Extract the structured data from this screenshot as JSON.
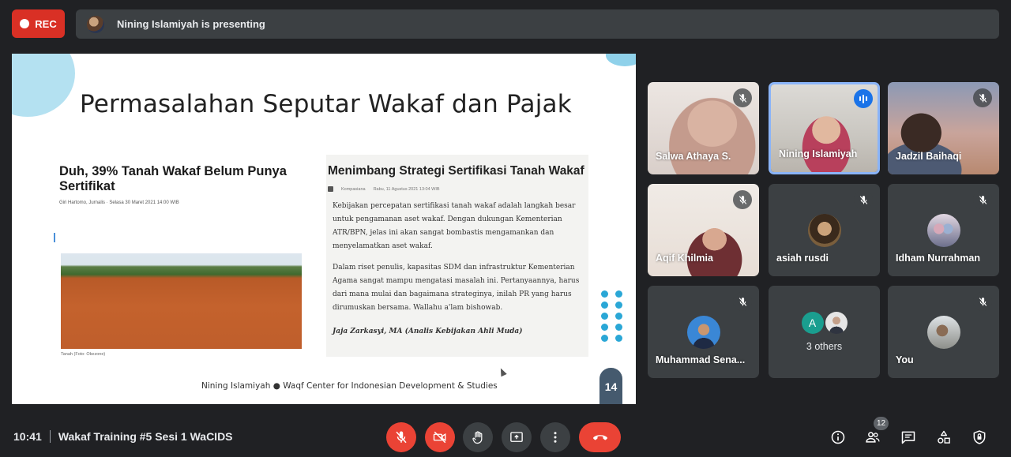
{
  "top": {
    "rec_label": "REC",
    "presenting_text": "Nining Islamiyah is presenting"
  },
  "slide": {
    "title": "Permasalahan Seputar Wakaf dan Pajak",
    "left_article": {
      "headline": "Duh, 39% Tanah Wakaf Belum Punya Sertifikat",
      "meta": "Giri Hartomo, Jurnalis  ·  Selasa 30 Maret 2021 14:00 WIB",
      "caption": "Tanah (Foto: Okezone)"
    },
    "right_article": {
      "headline": "Menimbang Strategi Sertifikasi Tanah Wakaf",
      "source": "Kompasiana",
      "date": "Rabu, 11 Agustus 2021 13:04 WIB",
      "para1": "Kebijakan percepatan sertifikasi tanah wakaf adalah langkah besar untuk pengamanan aset wakaf. Dengan dukungan Kementerian ATR/BPN, jelas ini akan sangat bombastis mengamankan dan menyelamatkan aset wakaf.",
      "para2": "Dalam riset penulis, kapasitas SDM dan infrastruktur Kementerian Agama sangat mampu mengatasi masalah ini. Pertanyaannya, harus dari mana mulai dan bagaimana strateginya, inilah PR yang harus dirumuskan bersama. Wallahu a'lam bishowab.",
      "author": "Jaja Zarkasyi, MA  (Analis Kebijakan Ahli Muda)"
    },
    "footer": "Nining Islamiyah ●   Waqf Center for Indonesian Development & Studies",
    "page_number": "14"
  },
  "participants": [
    {
      "name": "Salwa Athaya S.",
      "muted": true
    },
    {
      "name": "Nining Islamiyah",
      "speaking": true
    },
    {
      "name": "Jadzil Baihaqi",
      "muted": true
    },
    {
      "name": "Aqif Khilmia",
      "muted": true
    },
    {
      "name": "asiah rusdi",
      "muted": true
    },
    {
      "name": "Idham Nurrahman",
      "muted": true
    },
    {
      "name": "Muhammad Sena...",
      "muted": true
    },
    {
      "name": "3 others",
      "avatar_letter": "A"
    },
    {
      "name": "You",
      "muted": true
    }
  ],
  "bottom": {
    "time": "10:41",
    "meeting_title": "Wakaf Training #5 Sesi 1 WaCIDS",
    "participant_count": "12"
  },
  "colors": {
    "background": "#202124",
    "tile": "#3c4043",
    "red": "#ea4335",
    "active_border": "#8ab4f8",
    "slide_accent": "#2aa7d6"
  },
  "icons": [
    "mic-off-icon",
    "camera-off-icon",
    "raise-hand-icon",
    "present-screen-icon",
    "more-options-icon",
    "hang-up-icon",
    "info-icon",
    "people-icon",
    "chat-icon",
    "activities-icon",
    "host-controls-icon"
  ]
}
